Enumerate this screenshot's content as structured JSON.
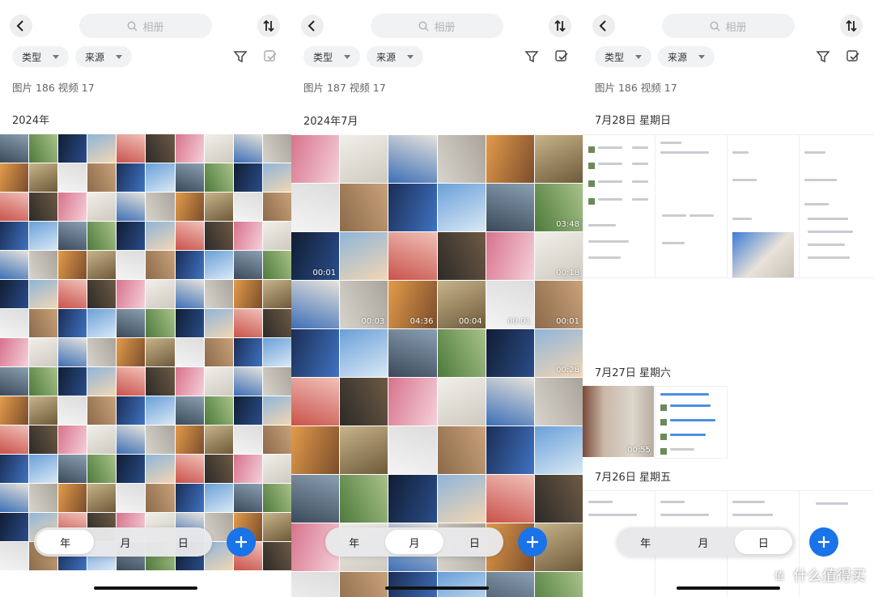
{
  "panels": [
    {
      "search_placeholder": "相册",
      "chip_type": "类型",
      "chip_source": "来源",
      "counts": "图片 186  视频 17",
      "sections": [
        "2024年"
      ],
      "tabs": [
        "年",
        "月",
        "日"
      ],
      "active_tab": 0
    },
    {
      "search_placeholder": "相册",
      "chip_type": "类型",
      "chip_source": "来源",
      "counts": "图片 187  视频 17",
      "sections": [
        "2024年7月"
      ],
      "durations": [
        "03:48",
        "00:01",
        "00:18",
        "00:03",
        "04:36",
        "00:04",
        "00:01",
        "00:01",
        "00:28"
      ],
      "tabs": [
        "年",
        "月",
        "日"
      ],
      "active_tab": 1
    },
    {
      "search_placeholder": "相册",
      "chip_type": "类型",
      "chip_source": "来源",
      "counts": "图片 186  视频 17",
      "sections": [
        "7月28日 星期日",
        "7月27日 星期六",
        "7月26日 星期五"
      ],
      "durations": [
        "00:55"
      ],
      "tabs": [
        "年",
        "月",
        "日"
      ],
      "active_tab": 2
    }
  ],
  "watermark": "什么值得买",
  "colors": {
    "accent": "#1a73e8",
    "chip_bg": "#f1f2f4",
    "placeholder": "#b3b3b3"
  },
  "icons": [
    "back-arrow-icon",
    "search-icon",
    "sort-icon",
    "caret-down-icon",
    "filter-icon",
    "select-icon",
    "plus-icon",
    "play-icon"
  ]
}
